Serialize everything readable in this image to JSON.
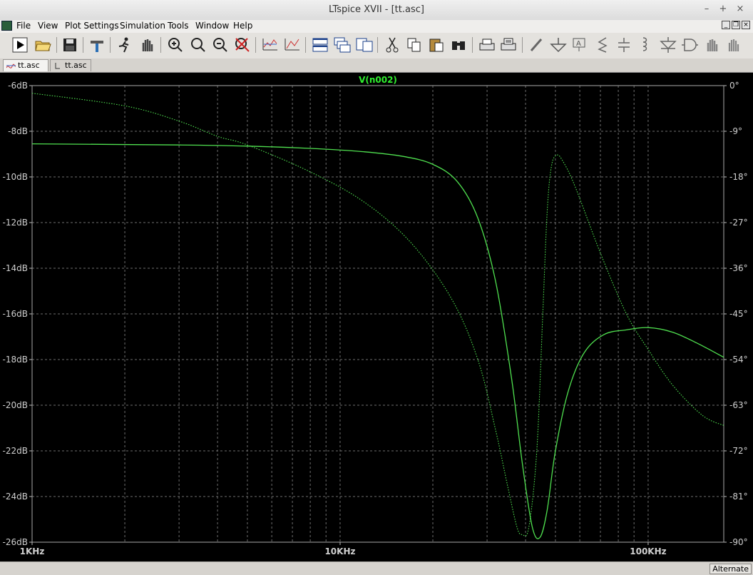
{
  "window": {
    "title": "LTspice XVII - [tt.asc]"
  },
  "menu": [
    "File",
    "View",
    "Plot Settings",
    "Simulation",
    "Tools",
    "Window",
    "Help"
  ],
  "tabs": [
    {
      "label": "tt.asc",
      "active": true
    },
    {
      "label": "tt.asc",
      "active": false
    }
  ],
  "toolbar": [
    "run-icon",
    "open-icon",
    "save-icon",
    "control-panel-icon",
    "halt-icon",
    "pan-icon",
    "zoom-in-icon",
    "zoom-area-icon",
    "zoom-out-icon",
    "zoom-cancel-icon",
    "autorange-icon",
    "fit-icon",
    "tile-horizontal-icon",
    "cascade-icon",
    "tile-vertical-icon",
    "cut-icon",
    "copy-icon",
    "paste-icon",
    "find-icon",
    "print-icon",
    "print-setup-icon",
    "wire-icon",
    "ground-icon",
    "label-icon",
    "resistor-icon",
    "capacitor-icon",
    "inductor-icon",
    "diode-icon",
    "component-icon",
    "move-icon",
    "drag-icon"
  ],
  "status": {
    "text": "Alternate"
  },
  "colors": {
    "trace": "#4fe04f",
    "grid": "#6e6e6e",
    "axis_text": "#cfcfcf",
    "title": "#2fef2f"
  },
  "chart_data": {
    "type": "line",
    "title": "V(n002)",
    "x_scale": "log",
    "xlim": [
      1000,
      176000
    ],
    "x_ticks": [
      {
        "value": 1000,
        "label": "1KHz"
      },
      {
        "value": 10000,
        "label": "10KHz"
      },
      {
        "value": 100000,
        "label": "100KHz"
      }
    ],
    "y_left": {
      "unit": "dB",
      "ylim": [
        -26,
        -6
      ],
      "ticks": [
        "-6dB",
        "-8dB",
        "-10dB",
        "-12dB",
        "-14dB",
        "-16dB",
        "-18dB",
        "-20dB",
        "-22dB",
        "-24dB",
        "-26dB"
      ]
    },
    "y_right": {
      "unit": "°",
      "ylim": [
        -90,
        0
      ],
      "ticks": [
        "0°",
        "-9°",
        "-18°",
        "-27°",
        "-36°",
        "-45°",
        "-54°",
        "-63°",
        "-72°",
        "-81°",
        "-90°"
      ]
    },
    "grid": true,
    "series": [
      {
        "name": "magnitude",
        "axis": "left",
        "style": "solid",
        "points": [
          [
            1000,
            -8.55
          ],
          [
            3000,
            -8.6
          ],
          [
            5000,
            -8.65
          ],
          [
            8000,
            -8.75
          ],
          [
            12000,
            -8.9
          ],
          [
            16000,
            -9.1
          ],
          [
            20000,
            -9.45
          ],
          [
            24000,
            -10.2
          ],
          [
            28000,
            -11.8
          ],
          [
            32000,
            -14.6
          ],
          [
            36000,
            -18.8
          ],
          [
            39000,
            -22.5
          ],
          [
            42000,
            -25.3
          ],
          [
            44500,
            -25.8
          ],
          [
            47000,
            -24.6
          ],
          [
            50000,
            -22.0
          ],
          [
            55000,
            -19.4
          ],
          [
            62000,
            -17.7
          ],
          [
            72000,
            -16.9
          ],
          [
            85000,
            -16.7
          ],
          [
            100000,
            -16.6
          ],
          [
            120000,
            -16.8
          ],
          [
            145000,
            -17.3
          ],
          [
            176000,
            -17.9
          ]
        ]
      },
      {
        "name": "phase",
        "axis": "right",
        "style": "dotted",
        "points": [
          [
            1000,
            -1.5
          ],
          [
            2000,
            -4
          ],
          [
            3000,
            -7
          ],
          [
            4000,
            -10
          ],
          [
            5000,
            -11.7
          ],
          [
            8000,
            -17
          ],
          [
            12000,
            -23
          ],
          [
            17000,
            -31
          ],
          [
            23000,
            -42
          ],
          [
            28000,
            -54
          ],
          [
            32000,
            -68
          ],
          [
            35000,
            -79
          ],
          [
            37500,
            -87
          ],
          [
            39000,
            -88.5
          ],
          [
            41000,
            -87
          ],
          [
            43500,
            -72
          ],
          [
            45500,
            -45
          ],
          [
            47000,
            -25
          ],
          [
            48500,
            -16
          ],
          [
            50500,
            -13.7
          ],
          [
            53000,
            -15
          ],
          [
            58000,
            -20
          ],
          [
            70000,
            -33
          ],
          [
            85000,
            -45
          ],
          [
            100000,
            -52
          ],
          [
            120000,
            -59
          ],
          [
            150000,
            -65
          ],
          [
            176000,
            -67
          ]
        ]
      }
    ]
  }
}
